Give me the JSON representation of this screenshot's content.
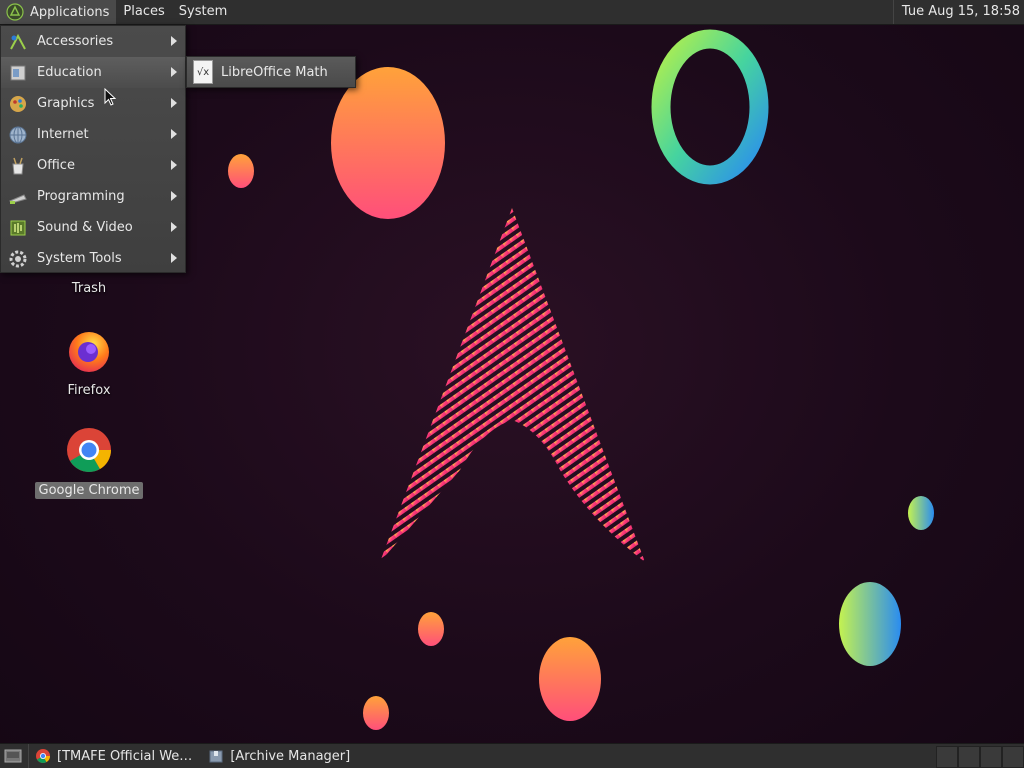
{
  "topbar": {
    "applications": "Applications",
    "places": "Places",
    "system": "System",
    "clock": "Tue Aug 15, 18:58"
  },
  "app_menu": {
    "items": [
      {
        "label": "Accessories",
        "icon": "accessories-icon"
      },
      {
        "label": "Education",
        "icon": "education-icon"
      },
      {
        "label": "Graphics",
        "icon": "graphics-icon"
      },
      {
        "label": "Internet",
        "icon": "internet-icon"
      },
      {
        "label": "Office",
        "icon": "office-icon"
      },
      {
        "label": "Programming",
        "icon": "programming-icon"
      },
      {
        "label": "Sound & Video",
        "icon": "sound-video-icon"
      },
      {
        "label": "System Tools",
        "icon": "system-tools-icon"
      }
    ],
    "highlighted": "Education"
  },
  "submenu": {
    "items": [
      {
        "label": "LibreOffice Math",
        "icon": "libreoffice-math-icon"
      }
    ]
  },
  "desktop": {
    "icons": [
      {
        "label": "Trash"
      },
      {
        "label": "Firefox"
      },
      {
        "label": "Google Chrome"
      }
    ]
  },
  "taskbar": {
    "tasks": [
      {
        "label": "[TMAFE Official We…",
        "icon": "chrome-icon"
      },
      {
        "label": "[Archive Manager]",
        "icon": "archive-manager-icon"
      }
    ]
  },
  "colors": {
    "panel": "#2f2f2f",
    "menu": "#464646",
    "desktop_bg": "#1c0a1a",
    "accent_pink": "#e0246e",
    "accent_orange": "#ff8a3d"
  }
}
